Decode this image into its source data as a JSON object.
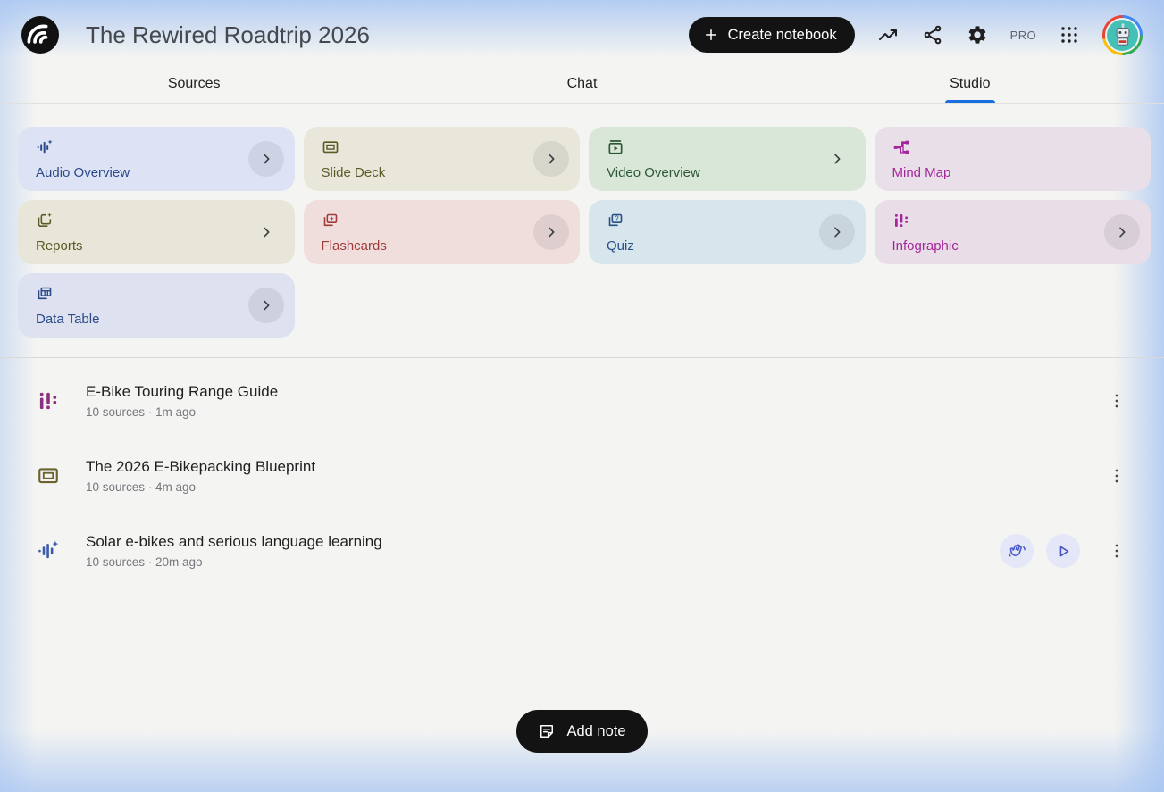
{
  "header": {
    "title": "The Rewired Roadtrip 2026",
    "create_notebook_label": "Create notebook",
    "pro_label": "PRO"
  },
  "tabs": {
    "sources": "Sources",
    "chat": "Chat",
    "studio": "Studio"
  },
  "studio_cards": [
    {
      "label": "Audio Overview",
      "icon": "audio-waveform-sparkle-icon",
      "bg": "#dde3f5",
      "fg": "#2b4a87",
      "chevron": "circle"
    },
    {
      "label": "Slide Deck",
      "icon": "slide-deck-icon",
      "bg": "#e8e7d9",
      "fg": "#5c5a26",
      "chevron": "circle"
    },
    {
      "label": "Video Overview",
      "icon": "video-overview-icon",
      "bg": "#d9e7d8",
      "fg": "#2d5636",
      "chevron": "plain"
    },
    {
      "label": "Mind Map",
      "icon": "mind-map-icon",
      "bg": "#e9dfe8",
      "fg": "#a3279b",
      "chevron": "none"
    },
    {
      "label": "Reports",
      "icon": "reports-sparkle-icon",
      "bg": "#e7e6d8",
      "fg": "#5c5a26",
      "chevron": "plain"
    },
    {
      "label": "Flashcards",
      "icon": "flashcards-star-icon",
      "bg": "#f0dedd",
      "fg": "#a03b3b",
      "chevron": "circle"
    },
    {
      "label": "Quiz",
      "icon": "quiz-cards-icon",
      "bg": "#d7e6ed",
      "fg": "#274f84",
      "chevron": "circle"
    },
    {
      "label": "Infographic",
      "icon": "infographic-bars-icon",
      "bg": "#e9dee8",
      "fg": "#a3279b",
      "chevron": "circle"
    },
    {
      "label": "Data Table",
      "icon": "data-table-icon",
      "bg": "#dde1f0",
      "fg": "#2b4a87",
      "chevron": "circle"
    }
  ],
  "artifacts": [
    {
      "title": "E-Bike Touring Range Guide",
      "meta": "10 sources · 1m ago",
      "icon": "infographic-bars-icon",
      "icon_color": "#8c2f80"
    },
    {
      "title": "The 2026 E-Bikepacking Blueprint",
      "meta": "10 sources · 4m ago",
      "icon": "slide-deck-icon",
      "icon_color": "#6b6430"
    },
    {
      "title": "Solar e-bikes and serious language learning",
      "meta": "10 sources · 20m ago",
      "icon": "audio-waveform-sparkle-icon",
      "icon_color": "#3c5ba9"
    }
  ],
  "add_note_label": "Add note",
  "colors": {
    "accent_tab_underline": "#1a6fde",
    "pill_button_bg": "#131314",
    "action_circle_bg": "#e4e7f8",
    "action_icon_color": "#4553c8"
  }
}
